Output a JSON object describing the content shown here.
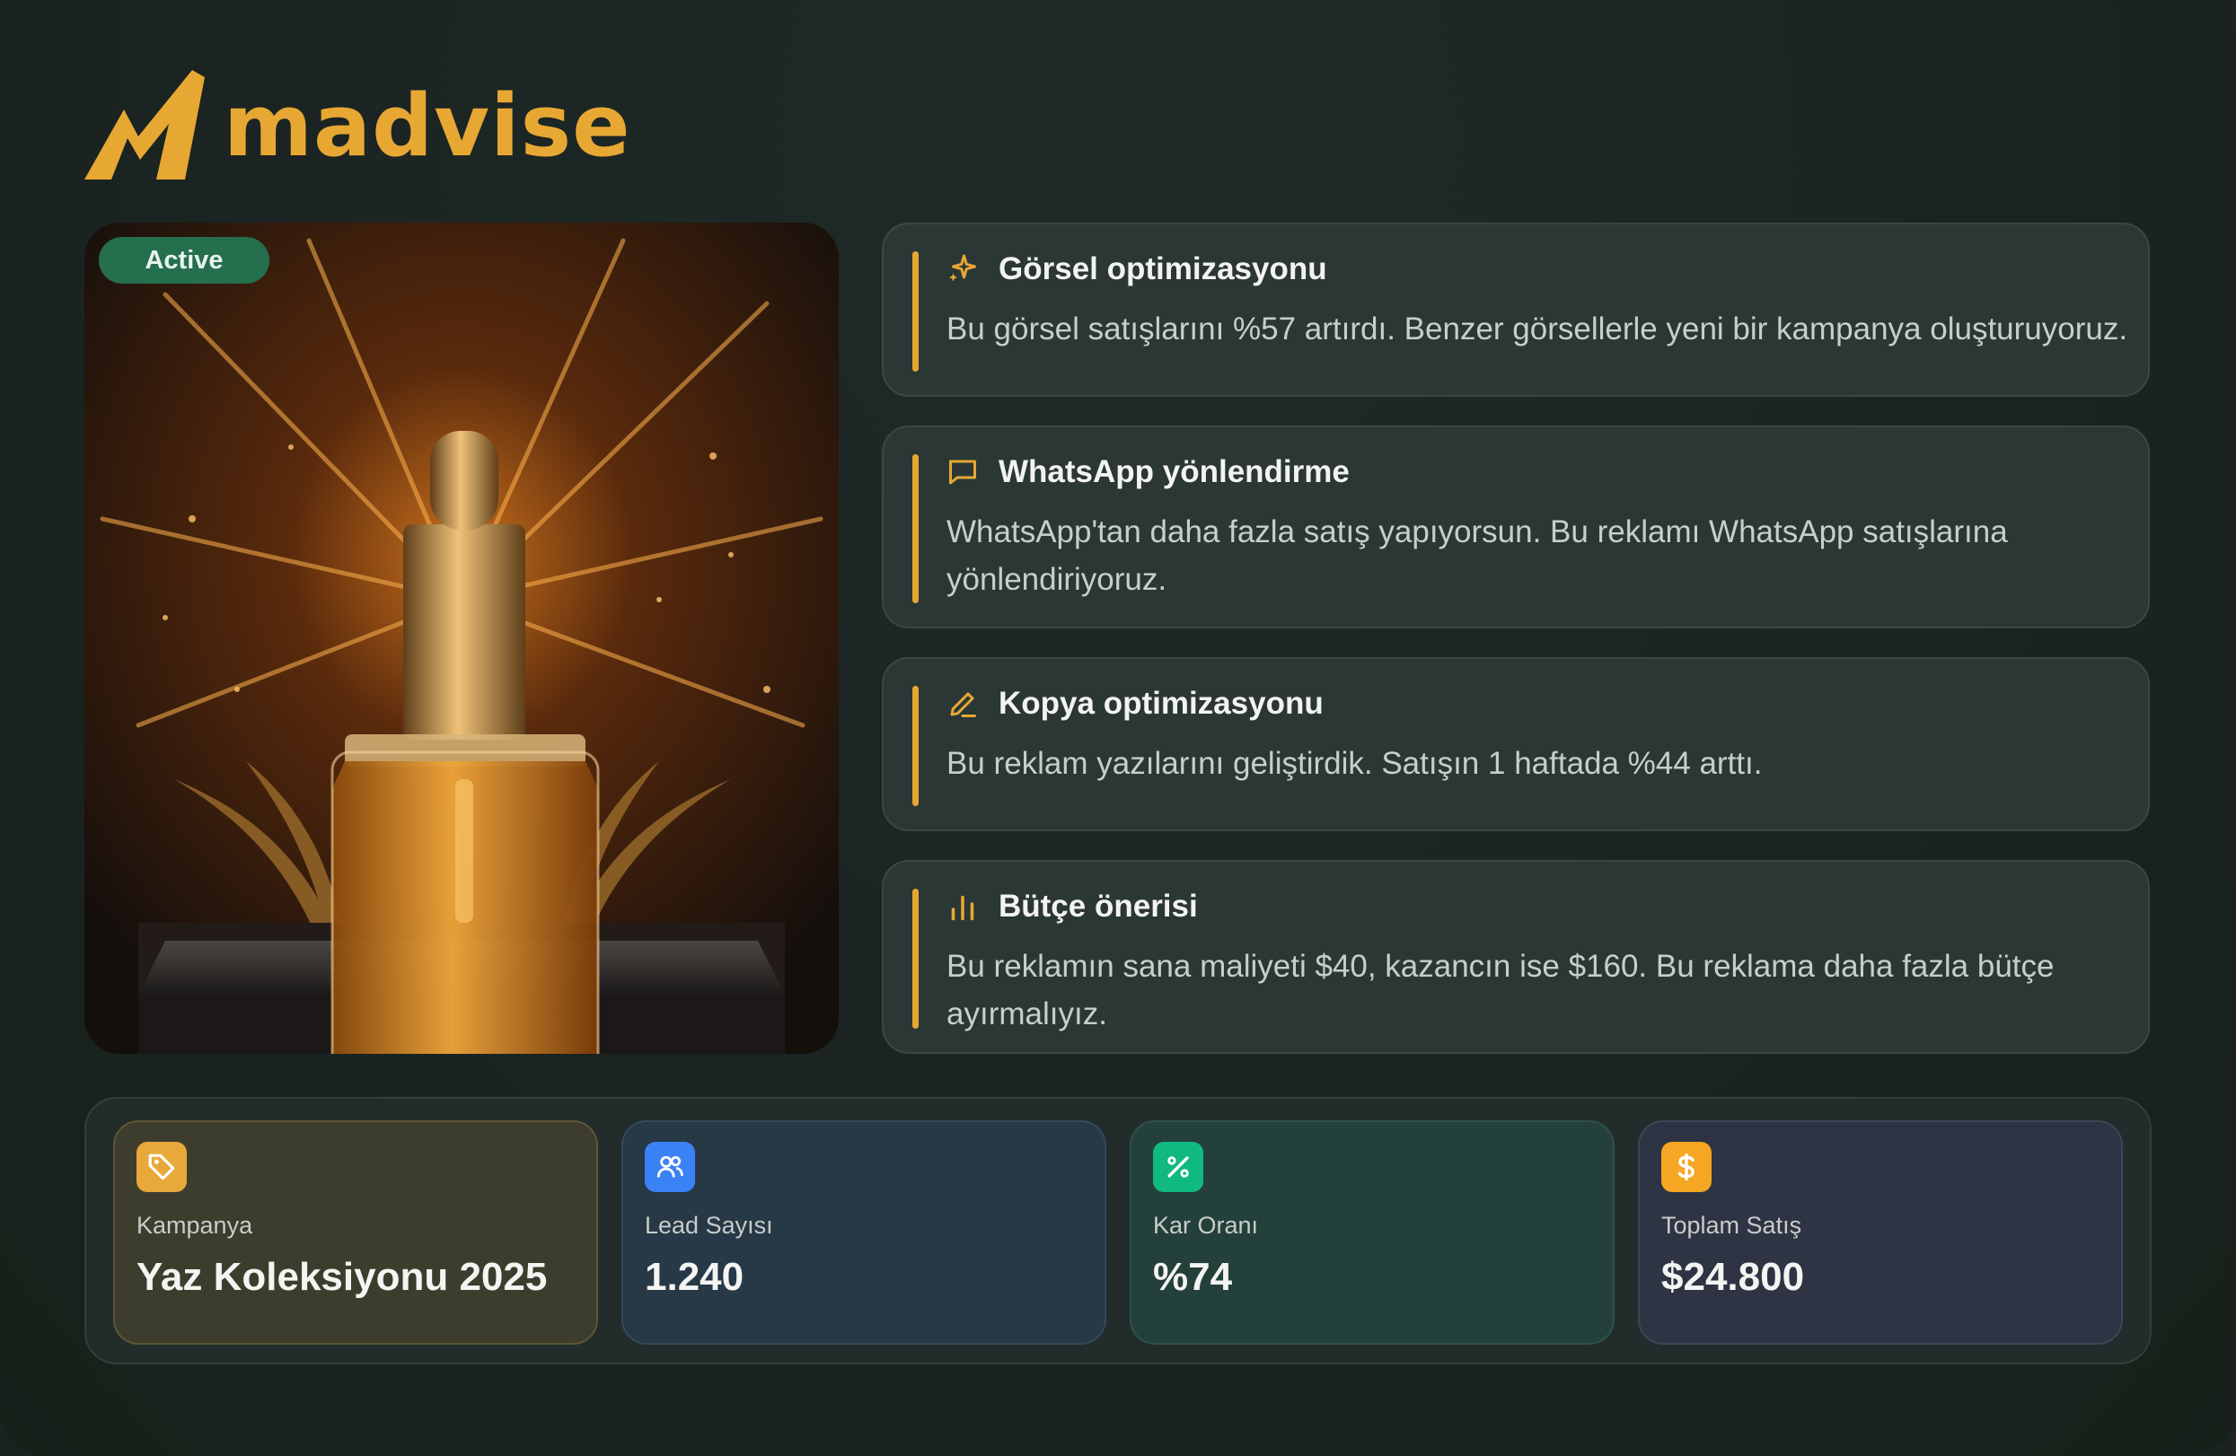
{
  "brand": {
    "name": "madvise",
    "color": "#e7a833"
  },
  "product": {
    "status_badge": "Active"
  },
  "insights": [
    {
      "icon": "sparkles-icon",
      "title": "Görsel optimizasyonu",
      "body": "Bu görsel satışlarını %57 artırdı. Benzer görsellerle yeni bir kampanya oluşturuyoruz."
    },
    {
      "icon": "message-icon",
      "title": "WhatsApp yönlendirme",
      "body": "WhatsApp'tan daha fazla satış yapıyorsun. Bu reklamı WhatsApp satışlarına yönlendiriyoruz."
    },
    {
      "icon": "pencil-icon",
      "title": "Kopya optimizasyonu",
      "body": "Bu reklam yazılarını geliştirdik. Satışın 1 haftada %44 arttı."
    },
    {
      "icon": "bar-chart-icon",
      "title": "Bütçe önerisi",
      "body": "Bu reklamın sana maliyeti $40, kazancın ise $160. Bu reklama daha fazla bütçe ayırmalıyız."
    }
  ],
  "stats": [
    {
      "icon": "tag-icon",
      "label": "Kampanya",
      "value": "Yaz Koleksiyonu 2025",
      "accent": "#e9a93a"
    },
    {
      "icon": "users-icon",
      "label": "Lead Sayısı",
      "value": "1.240",
      "accent": "#3b82f6"
    },
    {
      "icon": "percent-icon",
      "label": "Kar Oranı",
      "value": "%74",
      "accent": "#10b981"
    },
    {
      "icon": "dollar-icon",
      "label": "Toplam Satış",
      "value": "$24.800",
      "accent": "#f5a623"
    }
  ]
}
